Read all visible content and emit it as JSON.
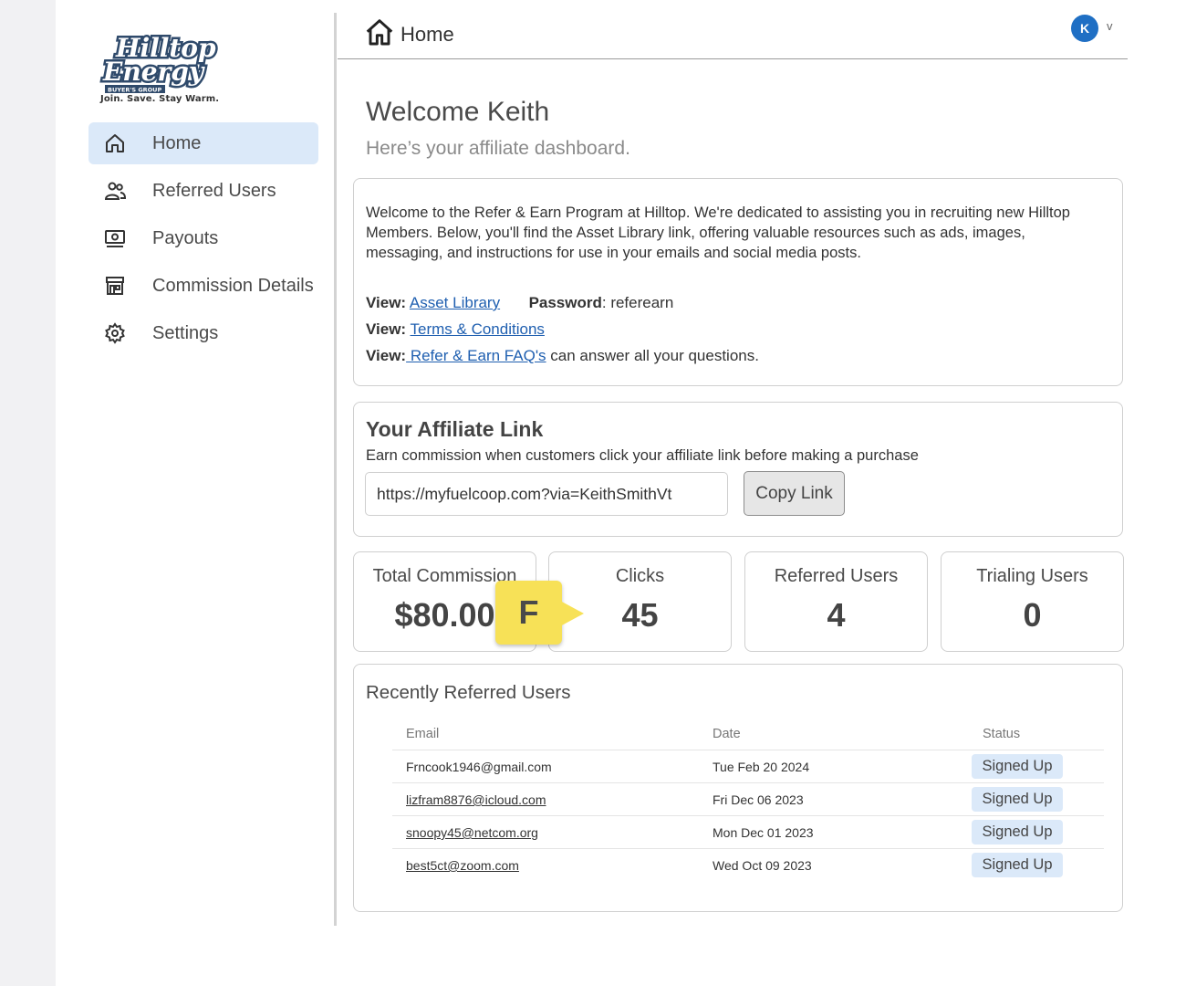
{
  "brand": {
    "logo_line1": "Hilltop",
    "logo_line2": "Energy",
    "logo_sub": "BUYER'S GROUP",
    "tagline": "Join. Save. Stay Warm."
  },
  "sidebar": {
    "items": [
      {
        "label": "Home",
        "icon": "home-icon",
        "active": true
      },
      {
        "label": "Referred Users",
        "icon": "users-icon"
      },
      {
        "label": "Payouts",
        "icon": "money-icon"
      },
      {
        "label": "Commission Details",
        "icon": "store-icon"
      },
      {
        "label": "Settings",
        "icon": "gear-icon"
      }
    ]
  },
  "header": {
    "title": "Home",
    "avatar_initial": "K",
    "chevron": "v"
  },
  "welcome": {
    "title": "Welcome Keith",
    "subtitle": "Here’s your affiliate dashboard."
  },
  "info": {
    "intro": "Welcome to the Refer & Earn Program at Hilltop. We're dedicated to assisting you in recruiting new Hilltop Members. Below, you'll find the Asset Library link, offering valuable resources such as ads, images, messaging, and instructions for use in your emails and social media posts.",
    "view_label": "View:",
    "asset_library": "Asset Library",
    "password_label": "Password",
    "password_value": ": referearn",
    "terms": "Terms & Conditions",
    "faq": " Refer & Earn FAQ's",
    "faq_suffix": " can answer all your questions."
  },
  "affiliate": {
    "title": "Your Affiliate Link",
    "subtitle": "Earn commission when customers click your affiliate link before making a purchase",
    "link": "https://myfuelcoop.com?via=KeithSmithVt",
    "copy_label": "Copy Link"
  },
  "stats": [
    {
      "label": "Total Commission",
      "value": "$80.00"
    },
    {
      "label": "Clicks",
      "value": "45"
    },
    {
      "label": "Referred Users",
      "value": "4"
    },
    {
      "label": "Trialing Users",
      "value": "0"
    }
  ],
  "callout": {
    "letter": "F"
  },
  "recent": {
    "title": "Recently Referred Users",
    "columns": [
      "Email",
      "Date",
      "Status"
    ],
    "rows": [
      {
        "email": "Frncook1946@gmail.com",
        "date": "Tue Feb 20 2024",
        "status": "Signed Up"
      },
      {
        "email": "lizfram8876@icloud.com",
        "date": "Fri Dec 06 2023",
        "status": "Signed Up"
      },
      {
        "email": "snoopy45@netcom.org",
        "date": "Mon Dec 01 2023",
        "status": "Signed Up"
      },
      {
        "email": "best5ct@zoom.com",
        "date": "Wed Oct 09 2023",
        "status": "Signed Up"
      }
    ]
  }
}
